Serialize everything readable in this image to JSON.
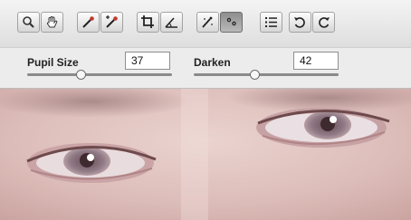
{
  "toolbar": {
    "tools": [
      {
        "icon": "zoom-icon",
        "active": false
      },
      {
        "icon": "hand-icon",
        "active": false
      },
      {
        "icon": "eyedropper-icon",
        "active": false
      },
      {
        "icon": "color-sampler-icon",
        "active": false
      },
      {
        "icon": "crop-icon",
        "active": false
      },
      {
        "icon": "straighten-icon",
        "active": false
      },
      {
        "icon": "spot-removal-icon",
        "active": false
      },
      {
        "icon": "red-eye-removal-icon",
        "active": true
      },
      {
        "icon": "preferences-list-icon",
        "active": false
      },
      {
        "icon": "rotate-left-icon",
        "active": false
      },
      {
        "icon": "rotate-right-icon",
        "active": false
      }
    ]
  },
  "options": {
    "pupil_size": {
      "label": "Pupil Size",
      "value": "37",
      "slider_fraction": 0.37
    },
    "darken": {
      "label": "Darken",
      "value": "42",
      "slider_fraction": 0.42
    }
  },
  "colors": {
    "active_tool": "#9a9a9a",
    "skin": "#e0c4c0"
  }
}
